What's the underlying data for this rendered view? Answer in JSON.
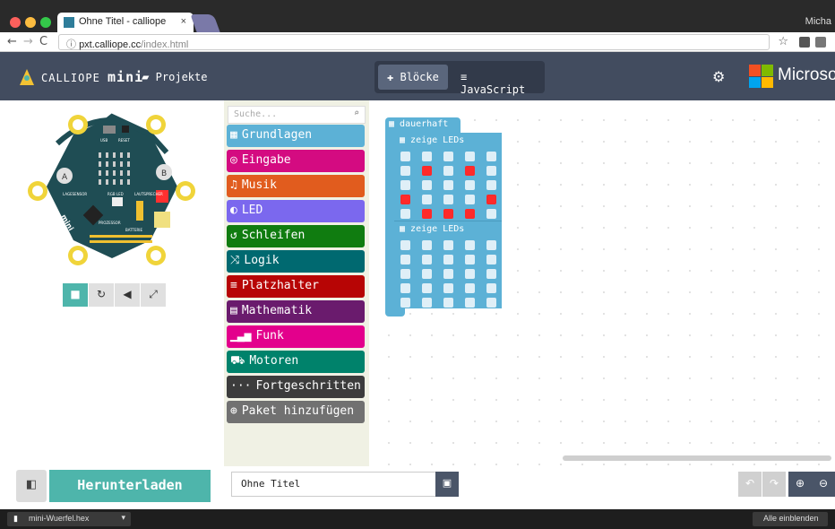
{
  "browser": {
    "tab_title": "Ohne Titel - calliope",
    "tab_close": "×",
    "profile_name": "Micha",
    "url_host": "pxt.calliope.cc",
    "url_path": "/index.html",
    "star": "☆"
  },
  "header": {
    "brand_prefix": "CALLIOPE",
    "brand_main": "mini",
    "projects_label": "Projekte",
    "blocks_label": "Blöcke",
    "javascript_label": "JavaScript",
    "settings_icon": "gear-icon",
    "microsoft_label": "Microsoft",
    "colors": {
      "bar": "#424c5f",
      "toggle_bg": "#323a4a",
      "toggle_active": "#5a667c"
    }
  },
  "toolbox": {
    "search_placeholder": "Suche...",
    "categories": [
      {
        "label": "Grundlagen",
        "icon": "grid-icon",
        "glyph": "▦",
        "color": "#5cb1d6"
      },
      {
        "label": "Eingabe",
        "icon": "target-icon",
        "glyph": "◎",
        "color": "#d40b81"
      },
      {
        "label": "Musik",
        "icon": "headphones-icon",
        "glyph": "♫",
        "color": "#e15c1e"
      },
      {
        "label": "LED",
        "icon": "toggle-icon",
        "glyph": "◐",
        "color": "#7b68ee"
      },
      {
        "label": "Schleifen",
        "icon": "loop-icon",
        "glyph": "↺",
        "color": "#107c10"
      },
      {
        "label": "Logik",
        "icon": "shuffle-icon",
        "glyph": "⤨",
        "color": "#006970"
      },
      {
        "label": "Platzhalter",
        "icon": "list-icon",
        "glyph": "≡",
        "color": "#b70505"
      },
      {
        "label": "Mathematik",
        "icon": "calculator-icon",
        "glyph": "▤",
        "color": "#6a1b6d"
      },
      {
        "label": "Funk",
        "icon": "signal-icon",
        "glyph": "▁▃▅",
        "color": "#e3008c"
      },
      {
        "label": "Motoren",
        "icon": "car-icon",
        "glyph": "⛟",
        "color": "#00826b"
      },
      {
        "label": "Fortgeschritten",
        "icon": "ellipsis-icon",
        "glyph": "···",
        "color": "#3c3c3c"
      },
      {
        "label": "Paket hinzufügen",
        "icon": "plus-circle-icon",
        "glyph": "⊕",
        "color": "#717171"
      }
    ]
  },
  "workspace": {
    "forever_label": "dauerhaft",
    "show_leds_label": "zeige LEDs",
    "led_grid_1": [
      [
        0,
        0,
        0,
        0,
        0
      ],
      [
        0,
        1,
        0,
        1,
        0
      ],
      [
        0,
        0,
        0,
        0,
        0
      ],
      [
        1,
        0,
        0,
        0,
        1
      ],
      [
        0,
        1,
        1,
        1,
        0
      ]
    ],
    "led_grid_2": [
      [
        0,
        0,
        0,
        0,
        0
      ],
      [
        0,
        0,
        0,
        0,
        0
      ],
      [
        0,
        0,
        0,
        0,
        0
      ],
      [
        0,
        0,
        0,
        0,
        0
      ],
      [
        0,
        0,
        0,
        0,
        0
      ]
    ],
    "colors": {
      "block": "#5cb1d6",
      "led_on": "#ff2a2a",
      "led_off": "#dfeff7"
    }
  },
  "simulator": {
    "board_labels": {
      "usb": "USB",
      "reset": "RESET",
      "lagesensor": "LAGESENSOR",
      "lautsprecher": "LAUTSPRECHER",
      "rgb_led": "RGB LED",
      "prozessor": "PROZESSOR",
      "batterie": "BATTERIE",
      "button_a": "A",
      "button_b": "B",
      "brand": "mini"
    }
  },
  "footer": {
    "download_label": "Herunterladen",
    "project_name": "Ohne Titel",
    "save_icon": "floppy-icon"
  },
  "statusbar": {
    "download_file": "mini-Wuerfel.hex",
    "show_all": "Alle einblenden"
  }
}
